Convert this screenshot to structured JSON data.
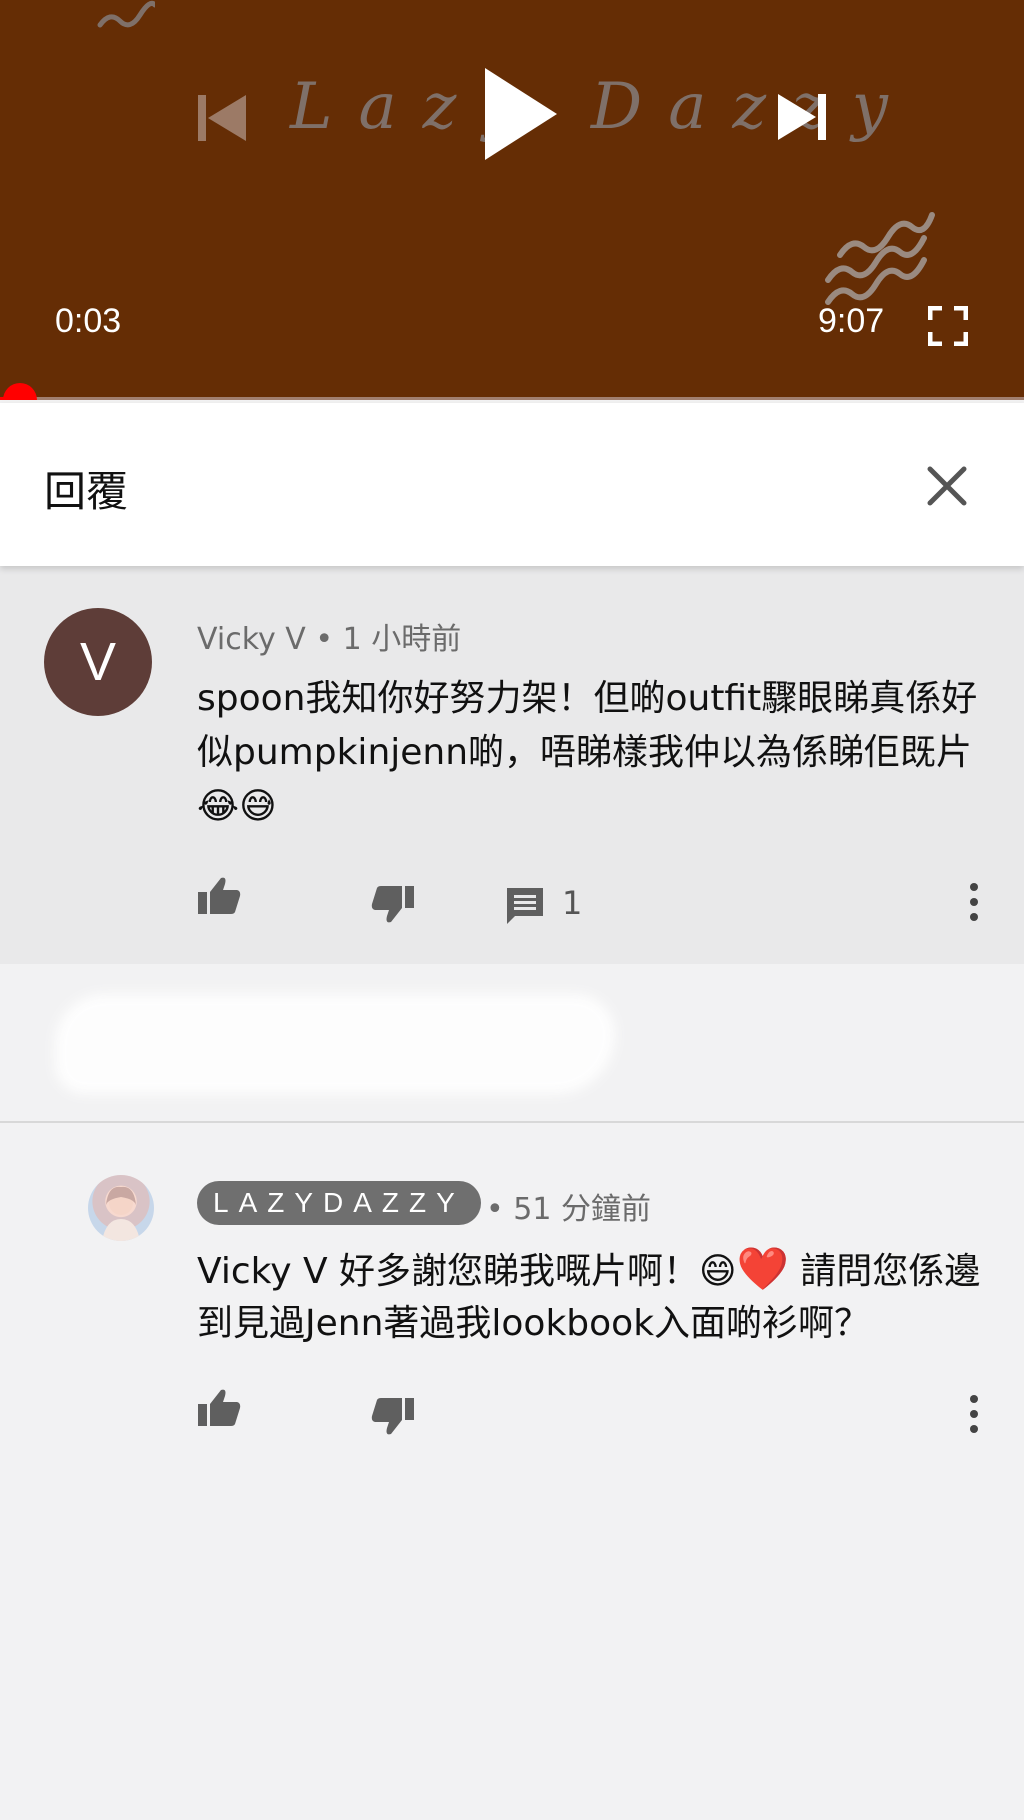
{
  "player": {
    "watermark_text": "Lazy Dazzy",
    "current_time": "0:03",
    "duration": "9:07",
    "progress_fraction": 0.0055,
    "colors": {
      "background": "#652d05",
      "progress": "#ff0000"
    },
    "icons": [
      "previous-icon",
      "play-icon",
      "next-icon",
      "fullscreen-icon"
    ]
  },
  "header": {
    "title": "回覆",
    "close_icon": "close-icon"
  },
  "parent_comment": {
    "avatar_letter": "V",
    "author": "Vicky V",
    "time": "1 小時前",
    "text_main": "spoon我知你好努力架！但啲outfit驟眼睇真係好似pumpkinjenn啲，唔睇樣我仲以為係睇佢既片",
    "emojis": [
      "😂",
      "😅"
    ],
    "reply_count": "1",
    "icons": [
      "thumbs-up-icon",
      "thumbs-down-icon",
      "comment-icon",
      "more-icon"
    ]
  },
  "reply": {
    "author": "LAZYDAZZY",
    "time": "51 分鐘前",
    "text_part1": "Vicky V 好多謝您睇我嘅片啊！",
    "emoji_grin": "😄",
    "emoji_heart": "❤️",
    "text_part2": "請問您係邊到見過Jenn著過我lookbook入面啲衫啊？",
    "icons": [
      "thumbs-up-icon",
      "thumbs-down-icon",
      "more-icon"
    ]
  }
}
